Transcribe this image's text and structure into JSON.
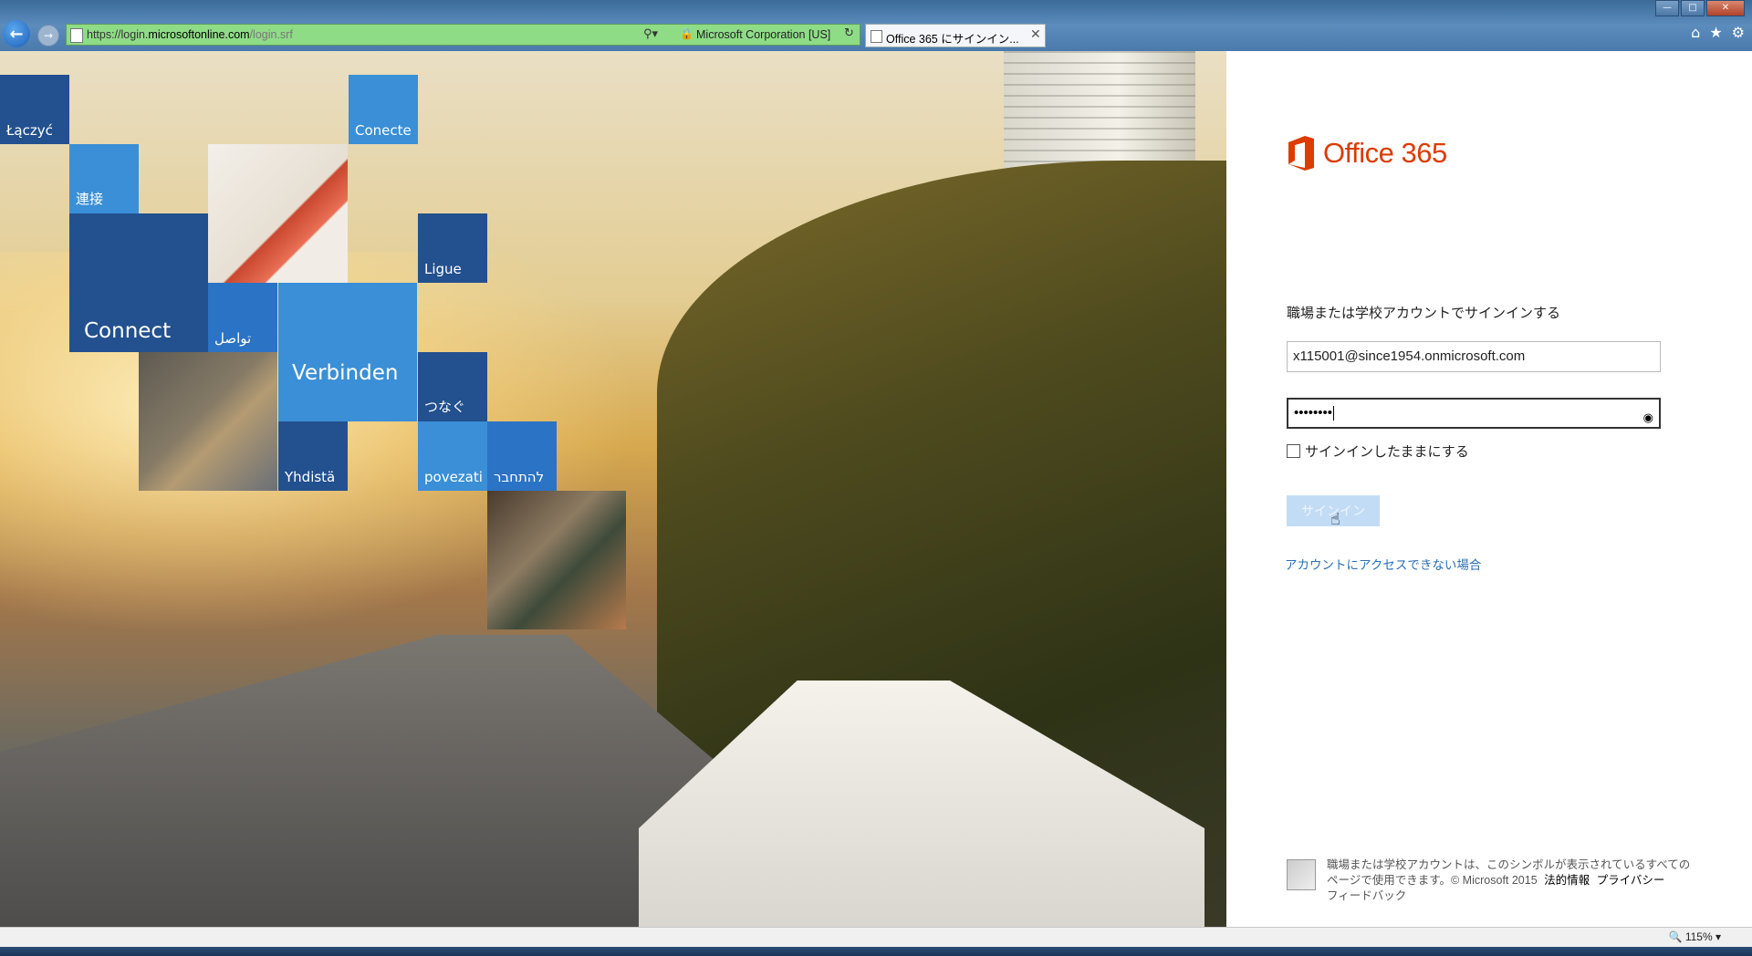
{
  "browser": {
    "url_prefix": "https://login.",
    "url_domain": "microsoftonline.com",
    "url_path": "/login.srf",
    "cert_label": "Microsoft Corporation [US]",
    "tab_title": "Office 365 にサインイン..."
  },
  "hero": {
    "tiles": [
      "Łączyć",
      "Conecte",
      "連接",
      "Ligue",
      "Connect",
      "تواصل",
      "Verbinden",
      "つなぐ",
      "Yhdistä",
      "povezati",
      "להתחבר"
    ]
  },
  "login": {
    "brand": "Office 365",
    "prompt": "職場または学校アカウントでサインインする",
    "email_value": "x115001@since1954.onmicrosoft.com",
    "password_mask": "••••••••",
    "remember_label": "サインインしたままにする",
    "signin_label": "サインイン",
    "help_link": "アカウントにアクセスできない場合"
  },
  "footer": {
    "text": "職場または学校アカウントは、このシンボルが表示されているすべてのページで使用できます。© Microsoft 2015",
    "legal": "法的情報",
    "privacy": "プライバシー",
    "feedback": "フィードバック"
  },
  "status": {
    "zoom": "115%"
  },
  "colors": {
    "brand_orange": "#dc3c00",
    "tile_dark": "#23508f",
    "tile_light": "#3a8fd6",
    "link_blue": "#2a6fb5",
    "address_bar_green": "#8fdc87"
  }
}
